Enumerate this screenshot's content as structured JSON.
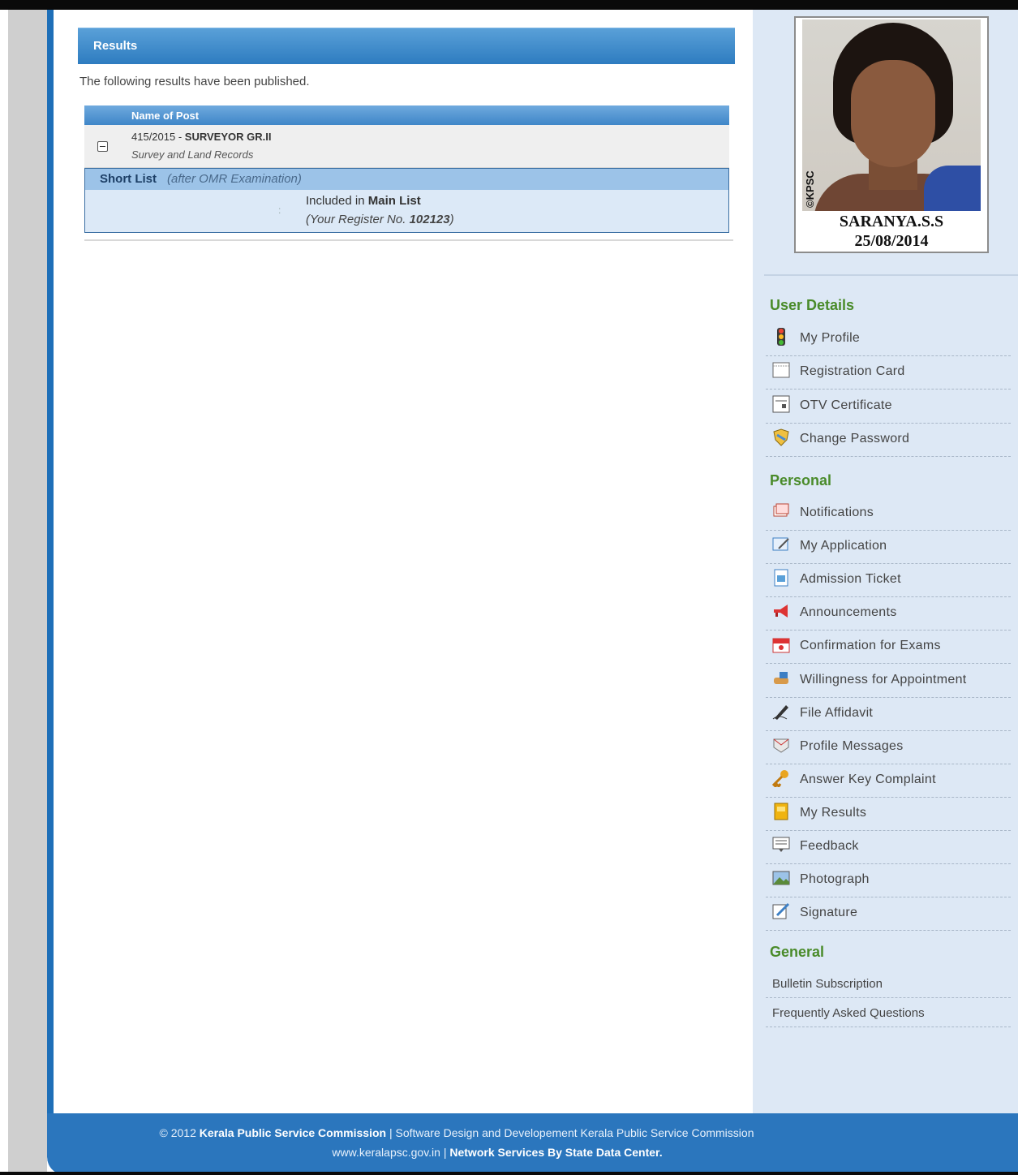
{
  "results": {
    "header": "Results",
    "intro": "The following results have been published.",
    "table_header": "Name of Post",
    "post_code": "415/2015 -",
    "post_name": "SURVEYOR GR.II",
    "department": "Survey and Land Records",
    "shortlist_label": "Short List",
    "shortlist_note": "(after OMR Examination)",
    "colon": ":",
    "included_prefix": "Included in",
    "included_list": "Main List",
    "register_prefix": "(Your Register No.",
    "register_no": "102123",
    "register_suffix": ")"
  },
  "profile": {
    "watermark": "©KPSC",
    "name": "SARANYA.S.S",
    "date": "25/08/2014"
  },
  "sidebar": {
    "user_details_title": "User Details",
    "user_details": [
      {
        "label": "My Profile",
        "icon": "traffic-light-icon"
      },
      {
        "label": "Registration Card",
        "icon": "card-icon"
      },
      {
        "label": "OTV Certificate",
        "icon": "certificate-icon"
      },
      {
        "label": "Change Password",
        "icon": "shield-icon"
      }
    ],
    "personal_title": "Personal",
    "personal": [
      {
        "label": "Notifications",
        "icon": "notification-icon"
      },
      {
        "label": "My Application",
        "icon": "application-icon"
      },
      {
        "label": "Admission Ticket",
        "icon": "ticket-icon"
      },
      {
        "label": "Announcements",
        "icon": "megaphone-icon"
      },
      {
        "label": "Confirmation for Exams",
        "icon": "calendar-icon"
      },
      {
        "label": "Willingness for Appointment",
        "icon": "handshake-icon"
      },
      {
        "label": "File Affidavit",
        "icon": "pen-icon"
      },
      {
        "label": "Profile Messages",
        "icon": "message-icon"
      },
      {
        "label": "Answer Key Complaint",
        "icon": "key-icon"
      },
      {
        "label": "My Results",
        "icon": "results-icon"
      },
      {
        "label": "Feedback",
        "icon": "feedback-icon"
      },
      {
        "label": "Photograph",
        "icon": "photo-icon"
      },
      {
        "label": "Signature",
        "icon": "signature-icon"
      }
    ],
    "general_title": "General",
    "general": [
      {
        "label": "Bulletin Subscription"
      },
      {
        "label": "Frequently Asked Questions"
      }
    ]
  },
  "footer": {
    "copyright": "© 2012",
    "org": "Kerala Public Service Commission",
    "sep1": " | Software Design and Developement Kerala Public Service Commission",
    "site": "www.keralapsc.gov.in",
    "sep2": " | ",
    "network": "Network Services By State Data Center."
  }
}
